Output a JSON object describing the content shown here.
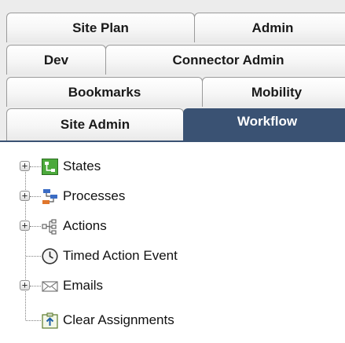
{
  "tabs": {
    "site_plan": "Site Plan",
    "admin": "Admin",
    "dev": "Dev",
    "connector_admin": "Connector Admin",
    "bookmarks": "Bookmarks",
    "mobility": "Mobility",
    "site_admin": "Site Admin",
    "workflow": "Workflow",
    "active": "Workflow"
  },
  "colors": {
    "active_tab": "#3a5273",
    "tab_border": "#9a9a9a",
    "tree_line": "#808080"
  },
  "tree": {
    "nodes": [
      {
        "label": "States",
        "icon": "states-icon",
        "expandable": true,
        "toggle": "+"
      },
      {
        "label": "Processes",
        "icon": "processes-icon",
        "expandable": true,
        "toggle": "+"
      },
      {
        "label": "Actions",
        "icon": "actions-icon",
        "expandable": true,
        "toggle": "+"
      },
      {
        "label": "Timed Action Event",
        "icon": "clock-icon",
        "expandable": false
      },
      {
        "label": "Emails",
        "icon": "email-icon",
        "expandable": true,
        "toggle": "+"
      },
      {
        "label": "Clear Assignments",
        "icon": "clear-assignments-icon",
        "expandable": false
      }
    ]
  }
}
